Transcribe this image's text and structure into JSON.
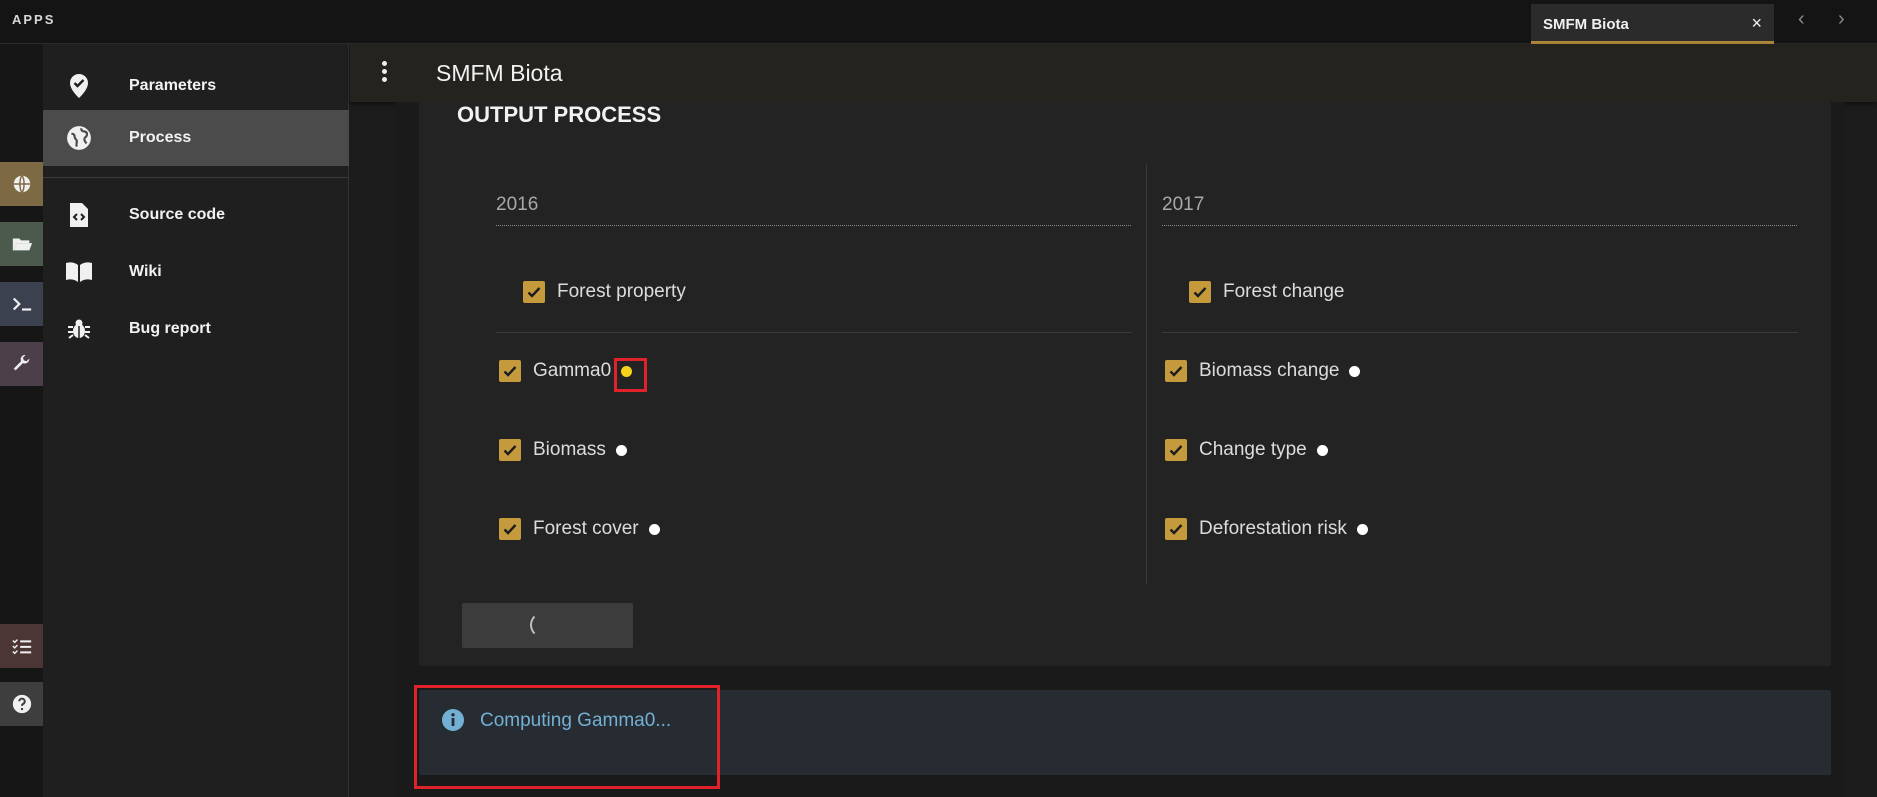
{
  "topbar": {
    "apps_label": "APPS",
    "tab_title": "SMFM Biota",
    "tab_close": "×",
    "prev_arrow": "‹",
    "next_arrow": "›"
  },
  "icon_rail": [
    {
      "icon": "globe-icon",
      "color": "#7d6a45"
    },
    {
      "icon": "folder-open-icon",
      "color": "#4b5a4d"
    },
    {
      "icon": "terminal-icon",
      "color": "#3c4150"
    },
    {
      "icon": "wrench-icon",
      "color": "#4c3f4a"
    },
    {
      "icon": "task-list-icon",
      "color": "#4c3535"
    },
    {
      "icon": "help-icon",
      "color": "#3e3e3e"
    }
  ],
  "sidebar": {
    "items": [
      {
        "label": "Parameters",
        "icon": "map-pin-check-icon"
      },
      {
        "label": "Process",
        "icon": "globe-icon",
        "active": true
      },
      {
        "label": "Source code",
        "icon": "file-code-icon"
      },
      {
        "label": "Wiki",
        "icon": "book-open-icon"
      },
      {
        "label": "Bug report",
        "icon": "bug-icon"
      }
    ]
  },
  "header": {
    "title": "SMFM Biota"
  },
  "card": {
    "section_title": "OUTPUT PROCESS",
    "col_2016": {
      "year": "2016",
      "top_option": "Forest property",
      "options": [
        "Gamma0",
        "Biomass",
        "Forest cover"
      ]
    },
    "col_2017": {
      "year": "2017",
      "top_option": "Forest change",
      "options": [
        "Biomass change",
        "Change type",
        "Deforestation risk"
      ]
    }
  },
  "alert": {
    "text": "Computing Gamma0..."
  },
  "colors": {
    "accent": "#c49a3c",
    "active_dot": "#f7d21b",
    "highlight": "#e0222a",
    "alert_text": "#74b0d4"
  }
}
